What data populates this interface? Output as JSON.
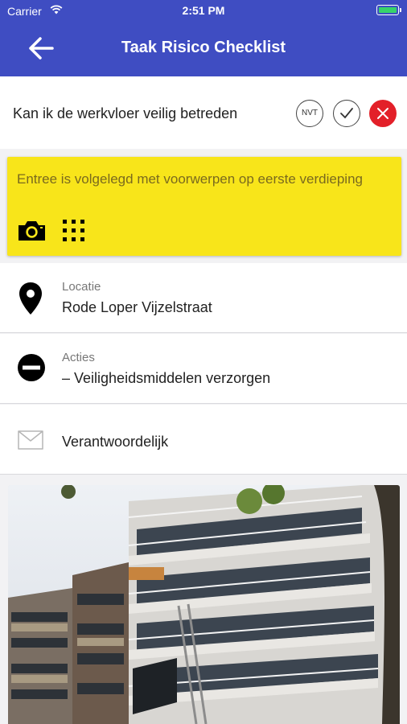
{
  "status_bar": {
    "carrier": "Carrier",
    "time": "2:51 PM"
  },
  "header": {
    "title": "Taak Risico Checklist",
    "back_icon": "arrow-left-icon"
  },
  "question": {
    "text": "Kan ik de werkvloer veilig betreden",
    "options": {
      "nvt": "NVT",
      "selected": "no"
    }
  },
  "note": {
    "text": "Entree is volgelegd met voorwerpen op eerste verdieping",
    "icons": [
      "camera-icon",
      "grid-icon"
    ]
  },
  "details": {
    "location": {
      "label": "Locatie",
      "value": "Rode Loper Vijzelstraat"
    },
    "actions": {
      "label": "Acties",
      "value": "– Veiligheidsmiddelen verzorgen"
    },
    "responsible": {
      "label": "Verantwoordelijk"
    }
  },
  "colors": {
    "header": "#3f4dc2",
    "note": "#f8e51a",
    "reject": "#e32029"
  }
}
